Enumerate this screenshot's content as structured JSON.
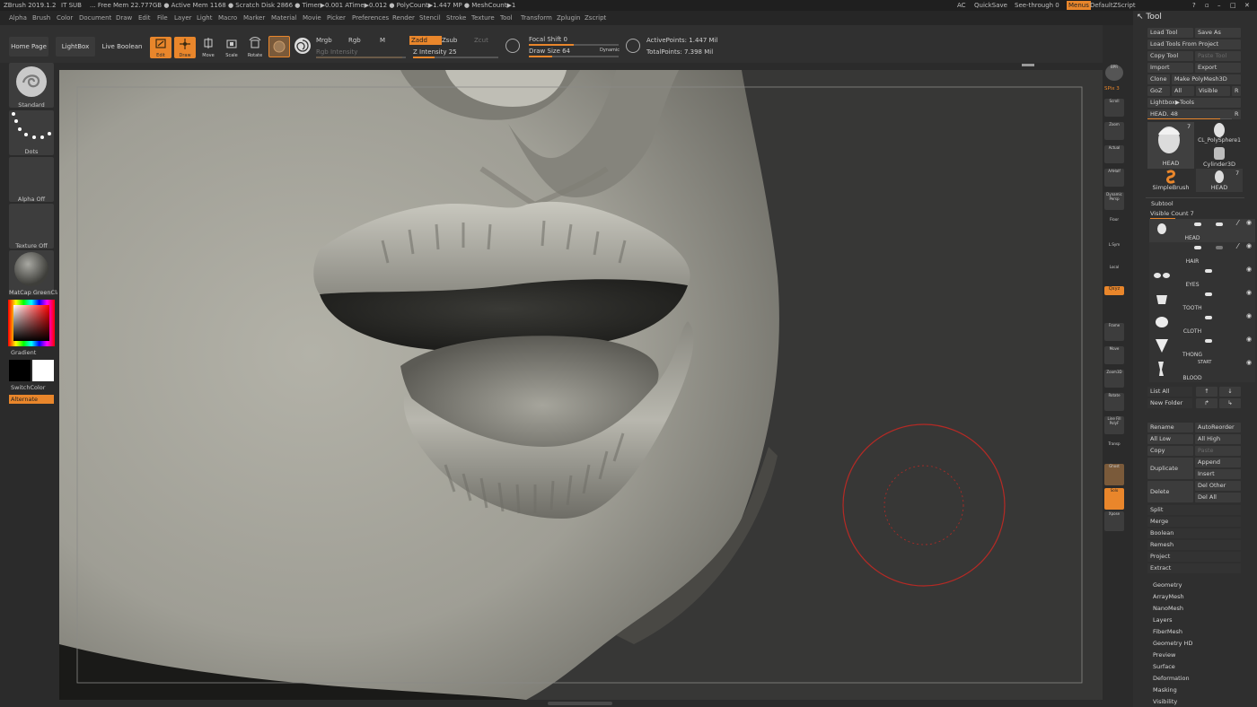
{
  "titlebar": {
    "app": "ZBrush 2019.1.2",
    "sub": "IT SUB",
    "stats": "... Free Mem 22.777GB ● Active Mem 1168 ● Scratch Disk 2866 ● Timer▶0.001 ATime▶0.012 ● PolyCount▶1.447 MP ● MeshCount▶1",
    "ac": "AC",
    "quicksave": "QuickSave",
    "seethrough": "See-through 0",
    "menus": "Menus",
    "script": "DefaultZScript"
  },
  "menubar": [
    "Alpha",
    "Brush",
    "Color",
    "Document",
    "Draw",
    "Edit",
    "File",
    "Layer",
    "Light",
    "Macro",
    "Marker",
    "Material",
    "Movie",
    "Picker",
    "Preferences",
    "Render",
    "Stencil",
    "Stroke",
    "Texture",
    "Tool",
    "Transform",
    "Zplugin",
    "Zscript"
  ],
  "shelf": {
    "home_page": "Home Page",
    "lightbox": "LightBox",
    "live_boolean": "Live Boolean",
    "edit": "Edit",
    "draw": "Draw",
    "move": "Move",
    "scale": "Scale",
    "rotate": "Rotate",
    "mrgb": "Mrgb",
    "rgb": "Rgb",
    "m": "M",
    "rgb_intensity": "Rgb Intensity",
    "zadd": "Zadd",
    "zsub": "Zsub",
    "zcut": "Zcut",
    "z_intensity": "Z Intensity 25",
    "focal_shift": "Focal Shift 0",
    "draw_size": "Draw Size 64",
    "dynamic": "Dynamic",
    "active_points": "ActivePoints: 1.447 Mil",
    "total_points": "TotalPoints: 7.398 Mil",
    "z_intensity_value": 25,
    "draw_size_value": 64
  },
  "lefttray": {
    "brush": "Standard",
    "stroke": "Dots",
    "alpha": "Alpha Off",
    "texture": "Texture Off",
    "material": "MatCap GreenClay",
    "gradient": "Gradient",
    "switchcolor": "SwitchColor",
    "alternate": "Alternate"
  },
  "rightshelf": [
    "BPR",
    "SPix 3",
    "Scroll",
    "Zoom",
    "Actual",
    "AAHalf",
    "Dynamic Persp",
    "Floor",
    "L.Sym",
    "Local",
    "Qxyz",
    "Frame",
    "Move",
    "Zoom3D",
    "Rotate",
    "Line Fill PolyF",
    "Transp",
    "Ghost",
    "Solo",
    "Xpose"
  ],
  "toolpanel": {
    "header": "Tool",
    "load_tool": "Load Tool",
    "save_as": "Save As",
    "load_from_project": "Load Tools From Project",
    "copy_tool": "Copy Tool",
    "paste_tool": "Paste Tool",
    "import": "Import",
    "export": "Export",
    "clone": "Clone",
    "make_polymesh": "Make PolyMesh3D",
    "goz": "GoZ",
    "all": "All",
    "visible": "Visible",
    "r": "R",
    "lightbox_tools": "Lightbox▶Tools",
    "head_slider": "HEAD. 48",
    "head_slider_value": 48,
    "thumbs": [
      {
        "name": "HEAD",
        "count": "7"
      },
      {
        "name": "CL_PolySphere1",
        "count": ""
      },
      {
        "name": "Cylinder3D",
        "count": ""
      },
      {
        "name": "SimpleBrush",
        "count": ""
      },
      {
        "name": "HEAD",
        "count": "7"
      }
    ],
    "subtool": "Subtool",
    "visible_count": "Visible Count 7",
    "subtools": [
      "HEAD",
      "HAIR",
      "EYES",
      "TOOTH",
      "CLOTH",
      "THONG",
      "BLOOD"
    ],
    "start": "START",
    "list_all": "List All",
    "new_folder": "New Folder",
    "rename": "Rename",
    "autoreorder": "AutoReorder",
    "all_low": "All Low",
    "all_high": "All High",
    "copy": "Copy",
    "paste": "Paste",
    "duplicate": "Duplicate",
    "append": "Append",
    "insert": "Insert",
    "delete": "Delete",
    "del_other": "Del Other",
    "del_all": "Del All",
    "actions": [
      "Split",
      "Merge",
      "Boolean",
      "Remesh",
      "Project",
      "Extract"
    ],
    "sections": [
      "Geometry",
      "ArrayMesh",
      "NanoMesh",
      "Layers",
      "FiberMesh",
      "Geometry HD",
      "Preview",
      "Surface",
      "Deformation",
      "Masking",
      "Visibility"
    ]
  },
  "colors": {
    "accent": "#e9862b",
    "brush_cursor": "#b52a25"
  }
}
